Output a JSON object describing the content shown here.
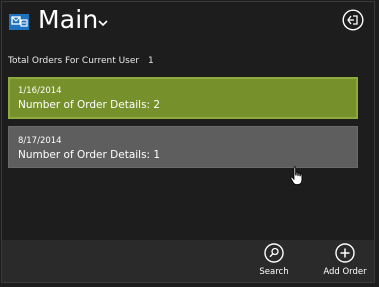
{
  "header": {
    "title": "Main",
    "app_icon": "app-logo-icon",
    "menu_icon": "chevron-down-icon",
    "logout_icon": "sign-out-icon"
  },
  "summary": {
    "label": "Total Orders For Current User",
    "count": "1"
  },
  "orders": [
    {
      "date": "1/16/2014",
      "details": "Number of Order Details: 2",
      "selected": true
    },
    {
      "date": "8/17/2014",
      "details": "Number of Order Details: 1",
      "selected": false
    }
  ],
  "appbar": {
    "search_label": "Search",
    "search_icon": "search-icon",
    "add_label": "Add Order",
    "add_icon": "plus-icon"
  },
  "colors": {
    "background": "#1d1d1d",
    "selected_tile": "#76902b",
    "tile": "#5e5e5e",
    "appbar": "#2a2a2a",
    "accent": "#1e73be"
  }
}
